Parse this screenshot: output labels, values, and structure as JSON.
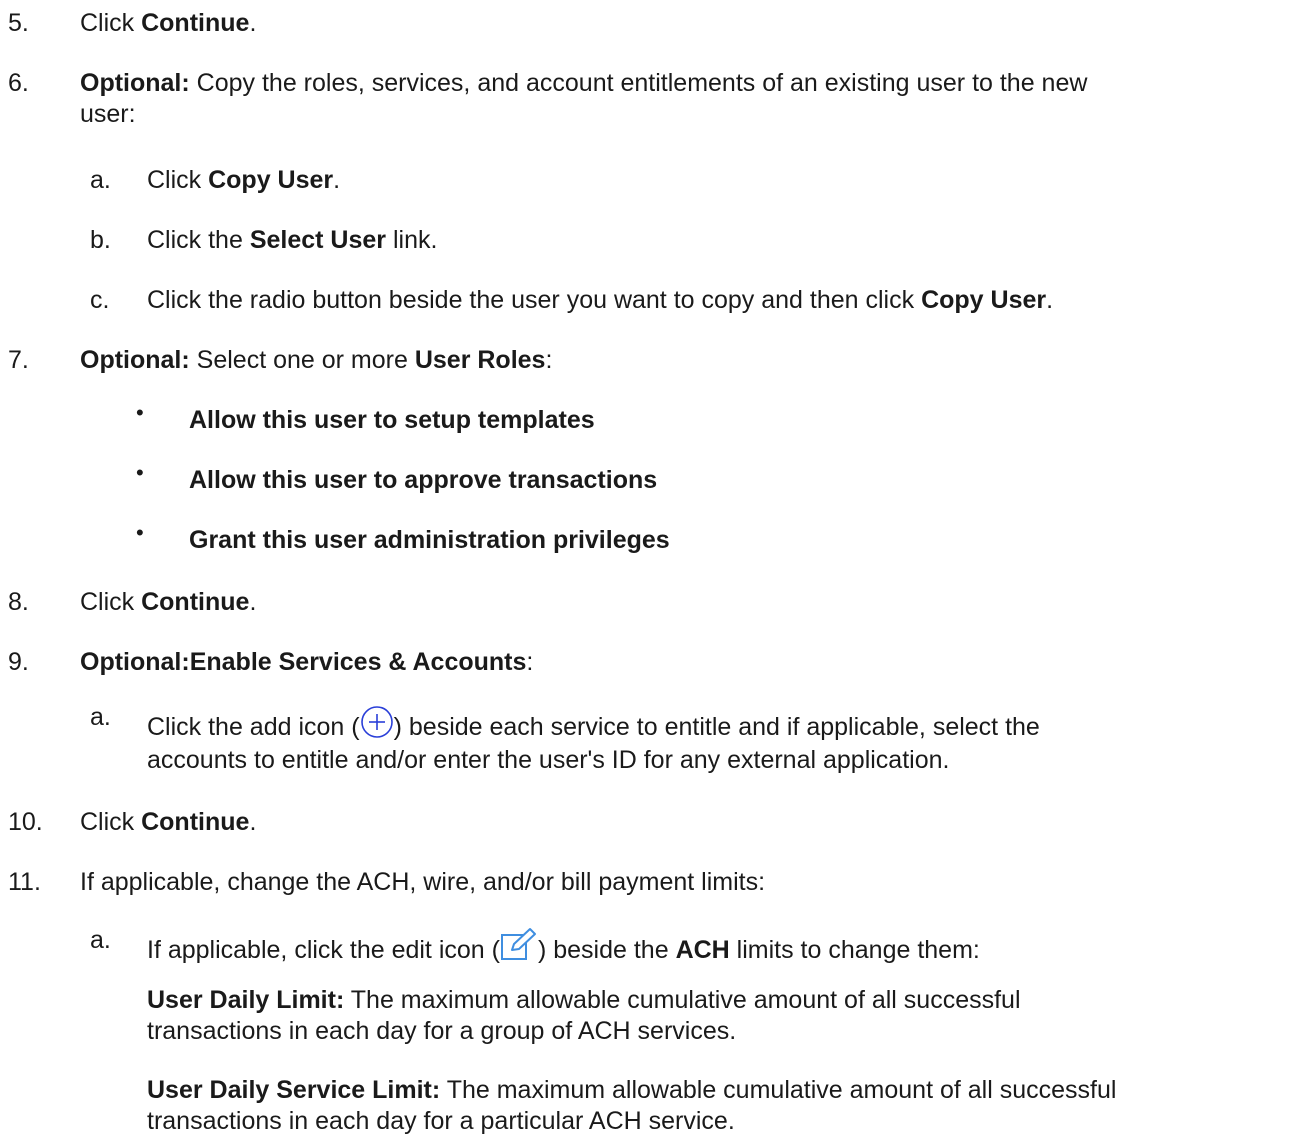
{
  "steps": {
    "s5": {
      "num": "5.",
      "pre": "Click ",
      "bold": "Continue",
      "post": "."
    },
    "s6": {
      "num": "6.",
      "bold": "Optional:",
      "line1": " Copy the roles, services, and account entitlements of an existing user to the new",
      "line2": "user:"
    },
    "s6a": {
      "num": "a.",
      "pre": "Click ",
      "bold": "Copy User",
      "post": "."
    },
    "s6b": {
      "num": "b.",
      "pre": "Click the ",
      "bold": "Select User",
      "post": " link."
    },
    "s6c": {
      "num": "c.",
      "pre": "Click the radio button beside the user you want to copy and then click ",
      "bold": "Copy User",
      "post": "."
    },
    "s7": {
      "num": "7.",
      "bold1": "Optional:",
      "mid": " Select one or more ",
      "bold2": "User Roles",
      "post": ":"
    },
    "b1": {
      "bullet": "•",
      "text": "Allow this user to setup templates"
    },
    "b2": {
      "bullet": "•",
      "text": "Allow this user to approve transactions"
    },
    "b3": {
      "bullet": "•",
      "text": "Grant this user administration privileges"
    },
    "s8": {
      "num": "8.",
      "pre": "Click ",
      "bold": "Continue",
      "post": "."
    },
    "s9": {
      "num": "9.",
      "bold": "Optional:Enable Services & Accounts",
      "post": ":"
    },
    "s9a": {
      "num": "a.",
      "pre": "Click the add icon (",
      "post": ") beside each service to entitle and if applicable, select the",
      "line2": "accounts to entitle and/or enter the user's ID for any external application."
    },
    "s10": {
      "num": "10.",
      "pre": "Click ",
      "bold": "Continue",
      "post": "."
    },
    "s11": {
      "num": "11.",
      "text": "If applicable, change the ACH, wire, and/or bill payment limits:"
    },
    "s11a": {
      "num": "a.",
      "pre": "If applicable, click the edit icon (",
      "mid": ") beside the ",
      "bold": "ACH",
      "post": "  limits to change them:"
    },
    "p1": {
      "bold": "User Daily Limit:",
      "line1": "  The maximum allowable cumulative amount of all successful",
      "line2": "transactions in each day for a group of ACH services."
    },
    "p2": {
      "bold": "User Daily Service Limit:",
      "line1": " The maximum allowable cumulative amount of all successful",
      "line2": "transactions in each day for a particular ACH service."
    }
  },
  "icons": {
    "add": "add-circle-icon",
    "edit": "edit-pencil-icon",
    "accent": "#2a3fd8",
    "edit_accent": "#3f8ee0"
  }
}
